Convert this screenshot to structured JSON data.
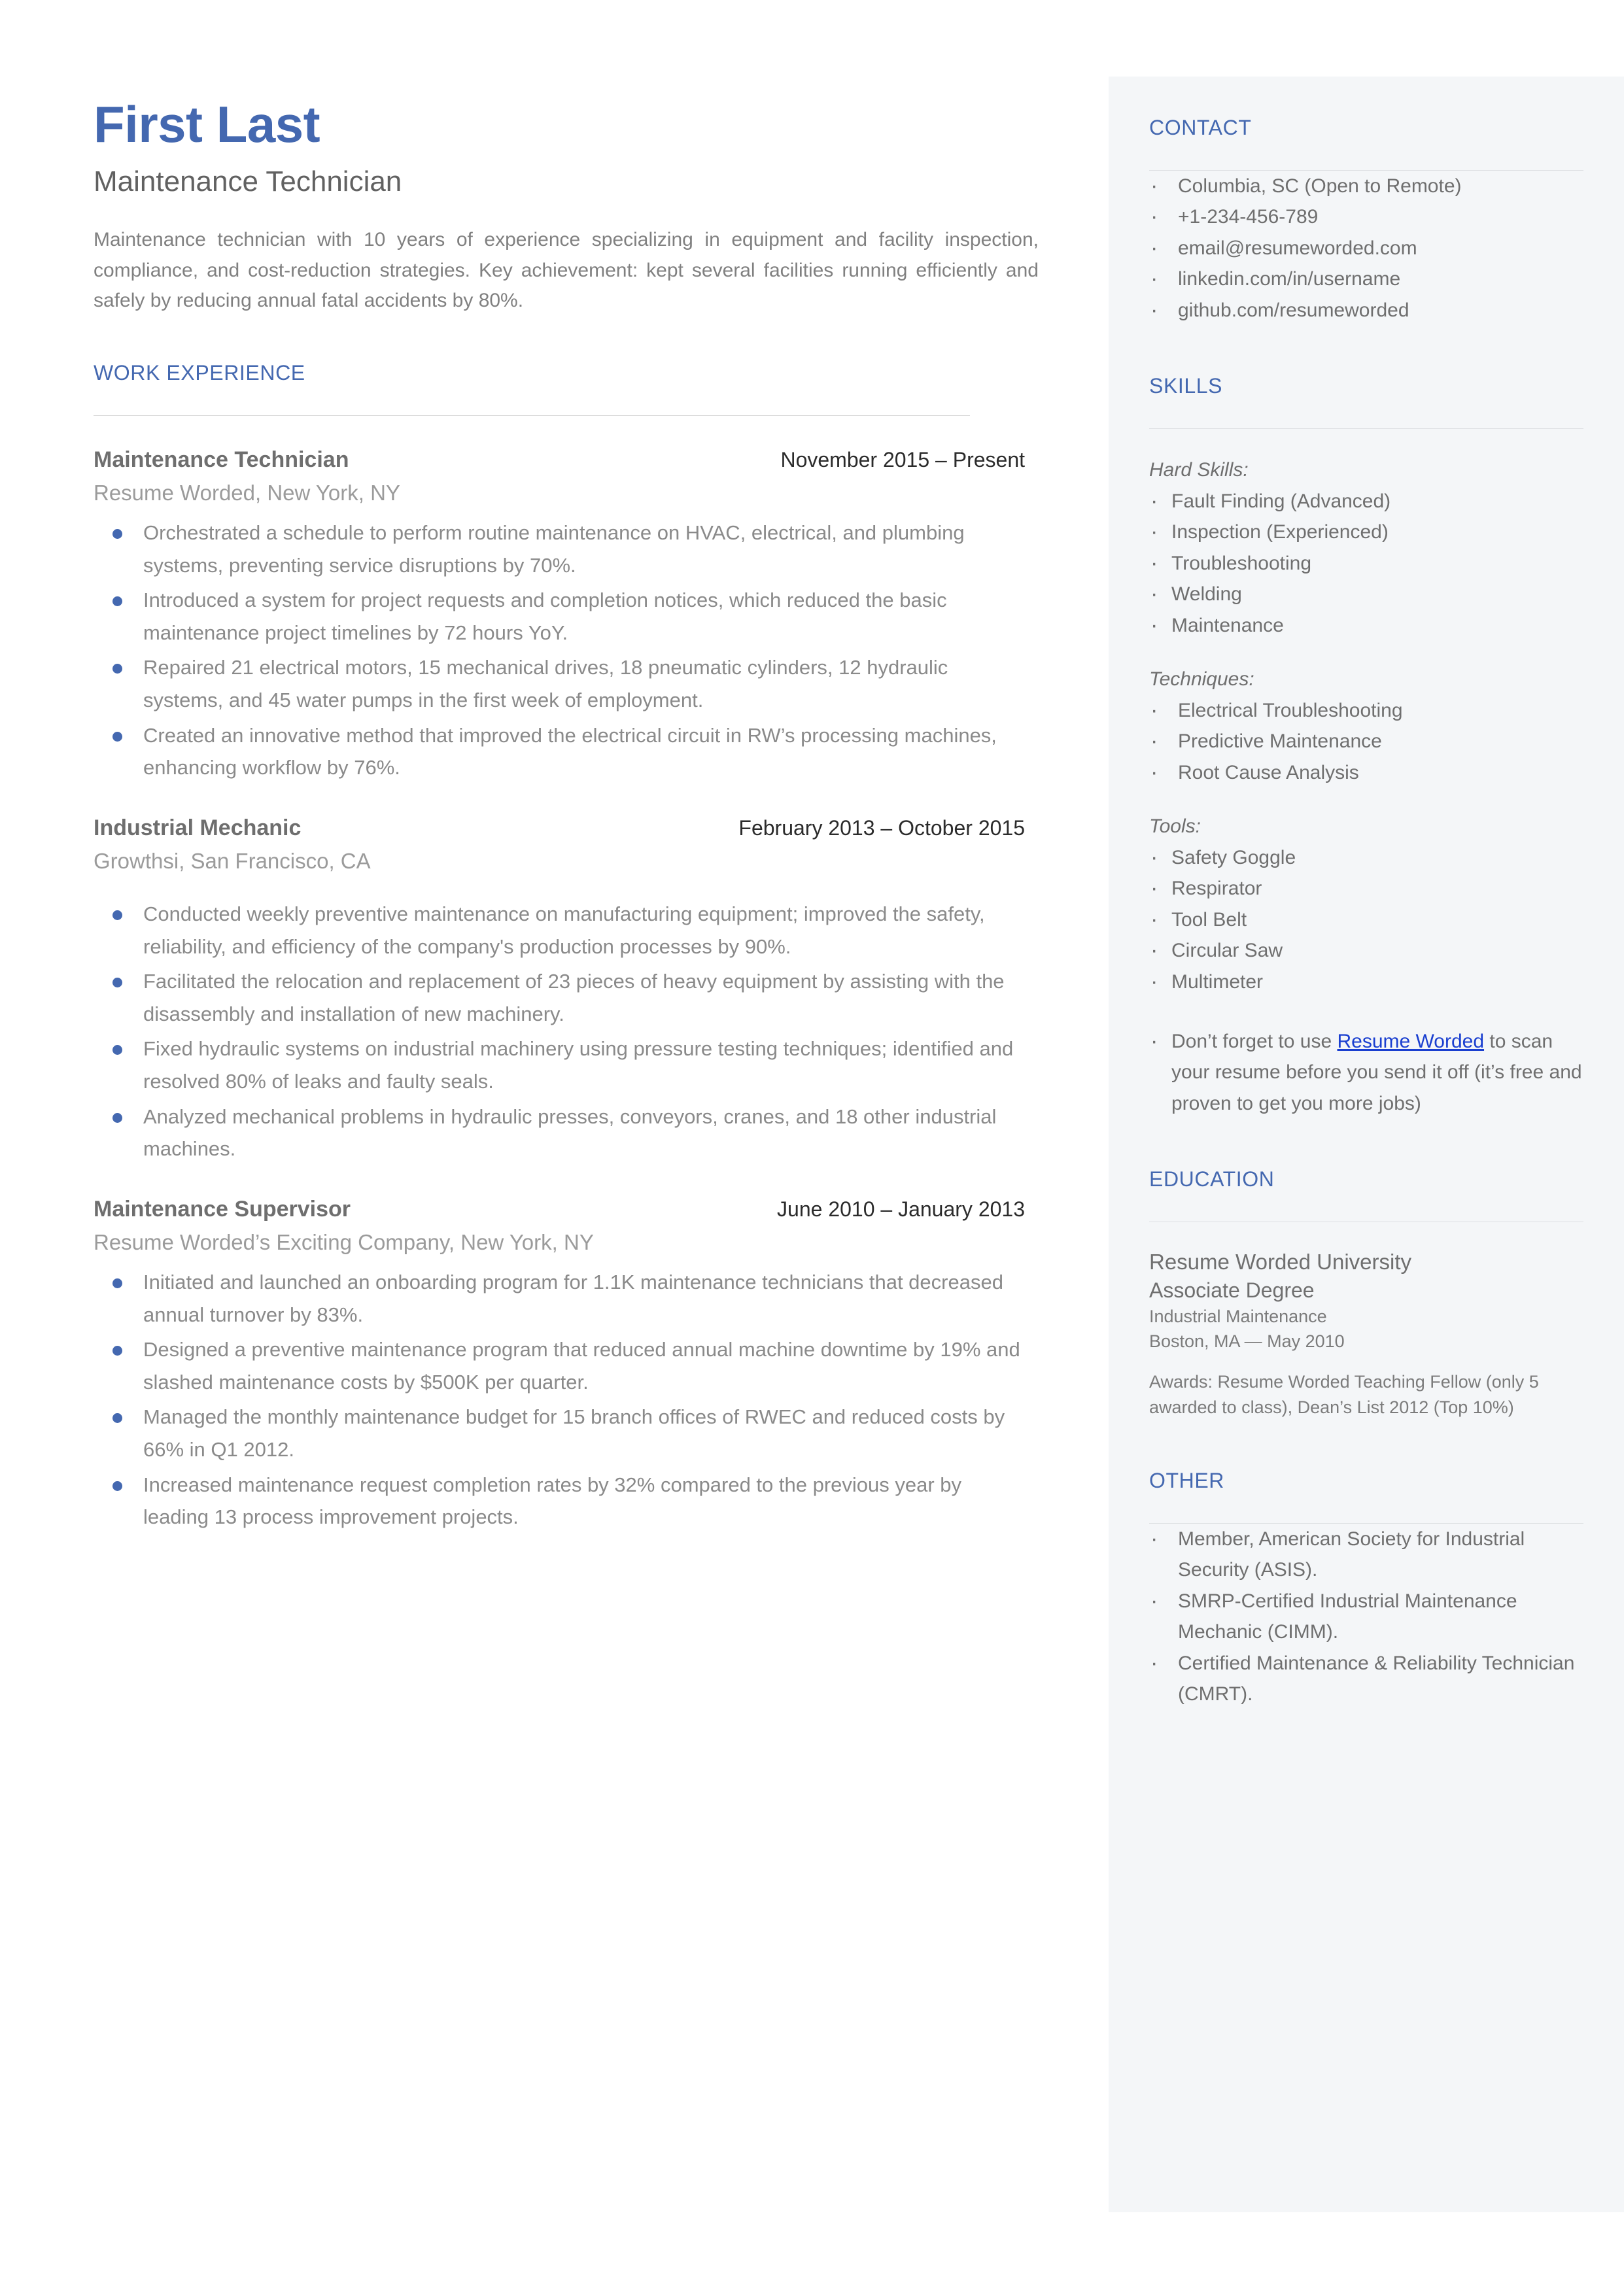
{
  "header": {
    "name": "First Last",
    "headline": "Maintenance Technician",
    "summary": "Maintenance technician with 10 years of experience specializing in equipment and facility inspection, compliance, and cost-reduction strategies. Key achievement: kept several facilities running efficiently and safely by reducing annual fatal accidents by 80%."
  },
  "colors": {
    "accent_blue": "#4468B0",
    "link_blue": "#1A3FD0",
    "sidebar_bg": "#F4F6F8",
    "body_gray": "#8A8A8A",
    "rule_gray": "#D9D9D9"
  },
  "work": {
    "section_title": "WORK EXPERIENCE",
    "jobs": [
      {
        "title": "Maintenance Technician",
        "dates": "November 2015 – Present",
        "company": "Resume Worded, New York, NY",
        "bullets": [
          "Orchestrated a schedule to perform routine maintenance on  HVAC, electrical, and plumbing systems, preventing service disruptions by 70%.",
          "Introduced a system for project requests and completion notices, which reduced the basic maintenance project timelines by 72 hours YoY.",
          "Repaired 21 electrical motors, 15 mechanical drives, 18 pneumatic cylinders, 12 hydraulic systems, and 45 water pumps in the first week of employment.",
          "Created an innovative method that improved the electrical circuit in RW’s processing machines, enhancing workflow by 76%."
        ]
      },
      {
        "title": "Industrial Mechanic",
        "dates": "February 2013 – October 2015",
        "company": "Growthsi, San Francisco, CA",
        "bullets": [
          "Conducted weekly preventive maintenance on manufacturing equipment; improved the safety, reliability, and efficiency of the company's production processes by 90%.",
          "Facilitated the relocation and replacement of 23 pieces of heavy equipment by assisting with the disassembly and installation of new machinery.",
          "Fixed hydraulic systems on industrial machinery using pressure testing techniques; identified and resolved 80% of leaks and faulty seals.",
          "Analyzed mechanical problems in hydraulic presses, conveyors, cranes, and 18 other industrial machines."
        ]
      },
      {
        "title": "Maintenance Supervisor",
        "dates": "June 2010 – January 2013",
        "company": "Resume Worded’s Exciting Company, New York, NY",
        "bullets": [
          "Initiated and launched an onboarding program for 1.1K maintenance technicians that decreased annual turnover by 83%.",
          "Designed a preventive maintenance program that reduced annual machine downtime by 19% and slashed maintenance costs by $500K per quarter.",
          "Managed the monthly maintenance budget for 15 branch offices of RWEC and reduced costs by 66% in Q1 2012.",
          "Increased maintenance request completion rates by 32% compared to the previous year by leading 13 process improvement projects."
        ]
      }
    ]
  },
  "sidebar": {
    "contact": {
      "title": "CONTACT",
      "items": [
        "Columbia, SC (Open to Remote)",
        "+1-234-456-789",
        "email@resumeworded.com",
        "linkedin.com/in/username",
        "github.com/resumeworded"
      ]
    },
    "skills": {
      "title": "SKILLS",
      "groups": [
        {
          "label": "Hard Skills:",
          "items": [
            "Fault Finding (Advanced)",
            "Inspection (Experienced)",
            "Troubleshooting",
            "Welding",
            "Maintenance"
          ]
        },
        {
          "label": "Techniques:",
          "items": [
            "Electrical Troubleshooting",
            "Predictive Maintenance",
            "Root Cause Analysis"
          ]
        },
        {
          "label": "Tools:",
          "items": [
            "Safety Goggle",
            "Respirator",
            "Tool Belt",
            "Circular Saw",
            "Multimeter"
          ]
        }
      ],
      "promo": {
        "before": "Don’t forget to use ",
        "link": "Resume Worded",
        "after": " to scan your resume before you send it off (it’s free and proven to get you more jobs)"
      }
    },
    "education": {
      "title": "EDUCATION",
      "school": "Resume Worded University",
      "degree": "Associate Degree",
      "field": "Industrial Maintenance",
      "where": "Boston, MA — May 2010",
      "awards": "Awards: Resume Worded Teaching Fellow (only 5 awarded to class), Dean’s List 2012 (Top 10%)"
    },
    "other": {
      "title": "OTHER",
      "items": [
        "Member, American Society for Industrial Security (ASIS).",
        "SMRP-Certified Industrial Maintenance Mechanic (CIMM).",
        "Certified Maintenance & Reliability Technician (CMRT)."
      ]
    }
  }
}
